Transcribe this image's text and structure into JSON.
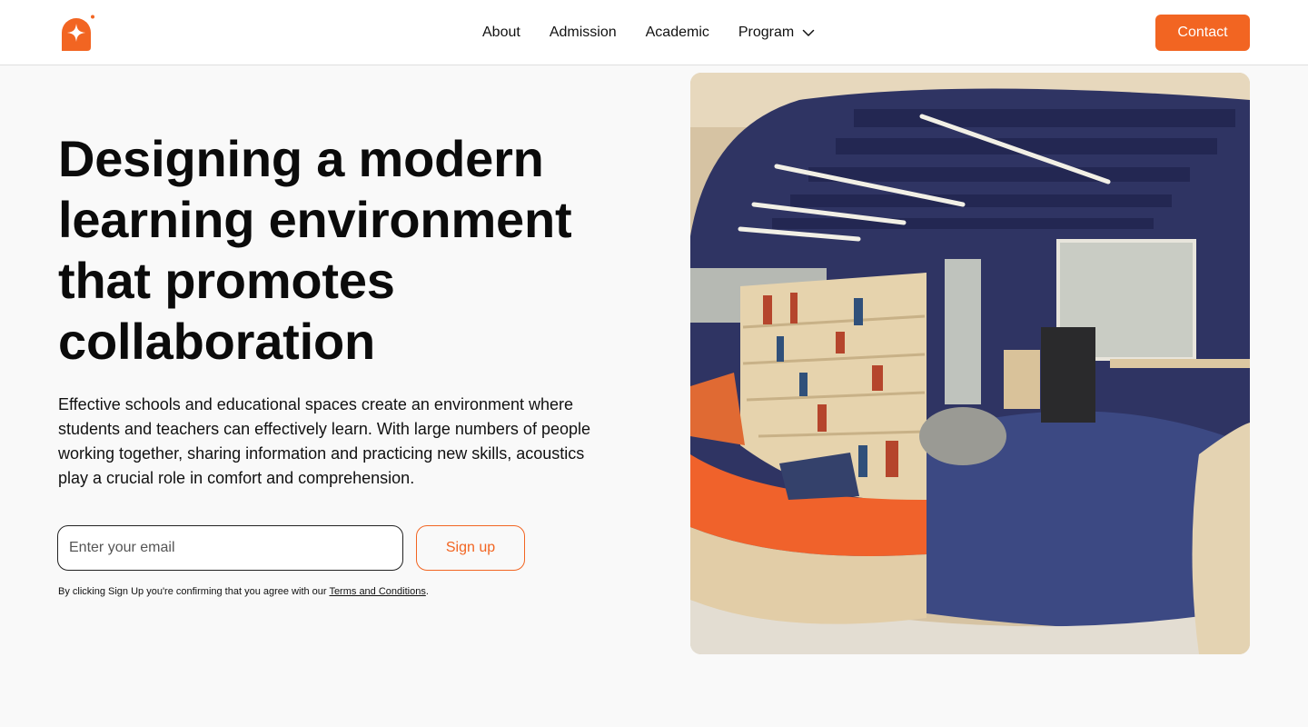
{
  "header": {
    "logo_icon": "sparkle-logo-icon",
    "nav": [
      {
        "label": "About"
      },
      {
        "label": "Admission"
      },
      {
        "label": "Academic"
      },
      {
        "label": "Program",
        "icon": "chevron-down-icon"
      }
    ],
    "contact_label": "Contact"
  },
  "hero": {
    "title": "Designing a modern learning environment that promotes collaboration",
    "description": "Effective schools and educational spaces create an environment where students and teachers can effectively learn. With large numbers of people working together, sharing information and practicing new skills, acoustics play a crucial role in comfort and comprehension.",
    "email_placeholder": "Enter your email",
    "signup_label": "Sign up",
    "terms_prefix": "By clicking Sign Up you're confirming that you agree with our ",
    "terms_link": "Terms and Conditions",
    "terms_suffix": ".",
    "image_icon": "library-interior-photo"
  },
  "colors": {
    "accent": "#f26522",
    "text": "#111111",
    "background": "#f9f9f9"
  }
}
